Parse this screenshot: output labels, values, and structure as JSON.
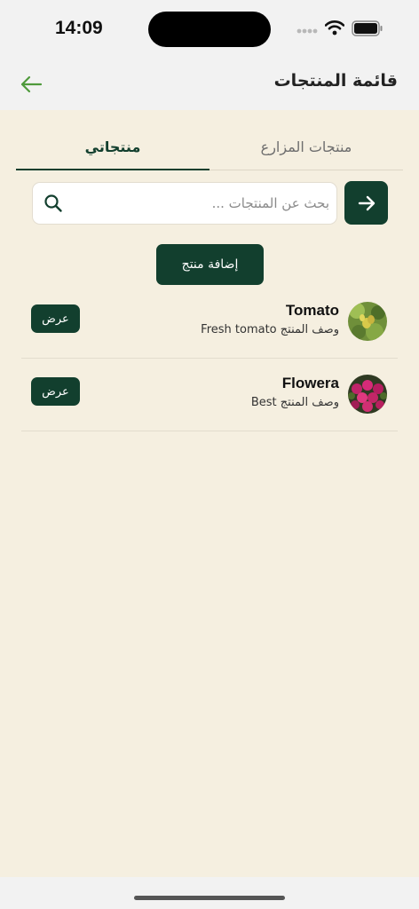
{
  "status_bar": {
    "time": "14:09"
  },
  "header": {
    "title": "قائمة المنتجات",
    "back_icon": "arrow-left-icon",
    "accent_color": "#4f9a3c"
  },
  "tabs": [
    {
      "label": "منتجات المزارع",
      "active": false
    },
    {
      "label": "منتجاتي",
      "active": true
    }
  ],
  "search": {
    "placeholder": "بحث عن المنتجات ...",
    "value": ""
  },
  "add_product_label": "إضافة منتج",
  "products": [
    {
      "name": "Tomato",
      "description": "وصف المنتج Fresh tomato",
      "view_label": "عرض",
      "image": "tomato-plant-photo"
    },
    {
      "name": "Flowera",
      "description": "وصف المنتج Best",
      "view_label": "عرض",
      "image": "flowers-photo"
    }
  ],
  "colors": {
    "primary": "#123f2e",
    "background": "#f5efe0"
  }
}
